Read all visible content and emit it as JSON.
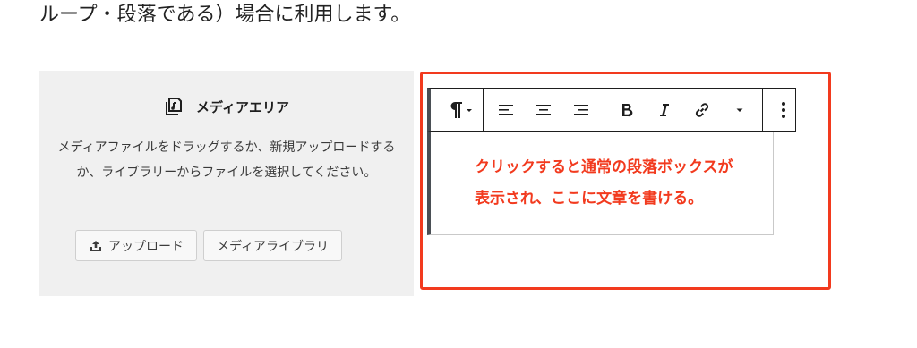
{
  "intro": {
    "text": "ループ・段落である）場合に利用します。"
  },
  "media_area": {
    "icon": "media-library-icon",
    "title": "メディアエリア",
    "description": "メディアファイルをドラッグするか、新規アップロードするか、ライブラリーからファイルを選択してください。",
    "upload_button": "アップロード",
    "library_button": "メディアライブラリ"
  },
  "toolbar": {
    "icons": [
      "paragraph-icon",
      "chevron-down-icon",
      "align-left-icon",
      "align-center-icon",
      "align-right-icon",
      "bold-icon",
      "italic-icon",
      "link-icon",
      "more-options-icon"
    ]
  },
  "annotation": {
    "line1": "クリックすると通常の段落ボックスが",
    "line2": "表示され、ここに文章を書ける。",
    "color": "#f23a1e"
  }
}
